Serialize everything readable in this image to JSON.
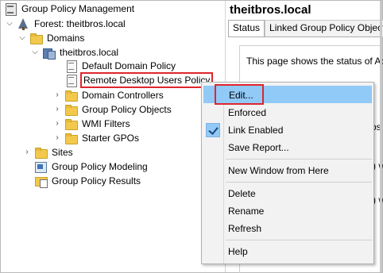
{
  "tree": {
    "root": "Group Policy Management",
    "forest": "Forest: theitbros.local",
    "domains": "Domains",
    "domain": "theitbros.local",
    "default_policy": "Default Domain Policy",
    "remote_policy": "Remote Desktop Users Policy",
    "domain_controllers": "Domain Controllers",
    "gpo_folder": "Group Policy Objects",
    "wmi_filters": "WMI Filters",
    "starter_gpos": "Starter GPOs",
    "sites": "Sites",
    "modeling": "Group Policy Modeling",
    "results": "Group Policy Results"
  },
  "right": {
    "title": "theitbros.local",
    "tabs": [
      "Status",
      "Linked Group Policy Objects"
    ],
    "status_text": "This page shows the status of Active",
    "fragments": [
      "ros",
      ") w",
      ") w"
    ]
  },
  "menu": {
    "items": [
      {
        "label": "Edit...",
        "state": "highlighted"
      },
      {
        "label": "Enforced"
      },
      {
        "label": "Link Enabled",
        "checked": true
      },
      {
        "label": "Save Report..."
      },
      {
        "label": "New Window from Here"
      },
      {
        "label": "Delete"
      },
      {
        "label": "Rename"
      },
      {
        "label": "Refresh"
      },
      {
        "label": "Help"
      }
    ]
  },
  "colors": {
    "highlight": "#91c9f7",
    "annotation_red": "#e0262d",
    "menu_bg": "#f2f2f2"
  }
}
